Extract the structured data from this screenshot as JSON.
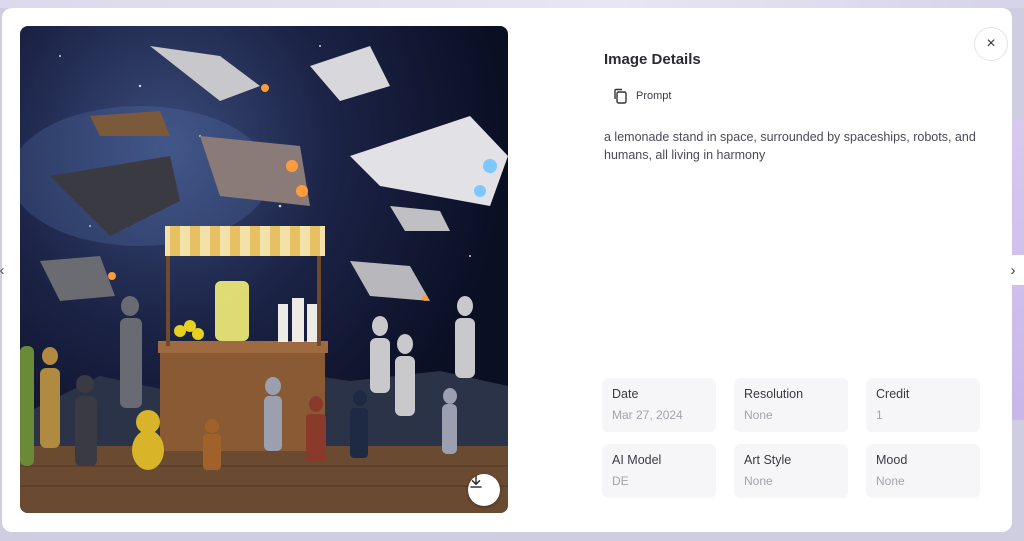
{
  "details": {
    "title": "Image Details",
    "prompt_label": "Prompt",
    "prompt_text": "a lemonade stand in space, surrounded by spaceships, robots, and humans, all living in harmony"
  },
  "meta": [
    {
      "label": "Date",
      "value": "Mar 27, 2024"
    },
    {
      "label": "Resolution",
      "value": "None"
    },
    {
      "label": "Credit",
      "value": "1"
    },
    {
      "label": "AI Model",
      "value": "DE"
    },
    {
      "label": "Art Style",
      "value": "None"
    },
    {
      "label": "Mood",
      "value": "None"
    }
  ],
  "controls": {
    "close": "×",
    "prev": "‹",
    "next": "›"
  },
  "icons": {
    "copy": "copy-icon",
    "download": "download-icon",
    "close": "close-icon"
  }
}
